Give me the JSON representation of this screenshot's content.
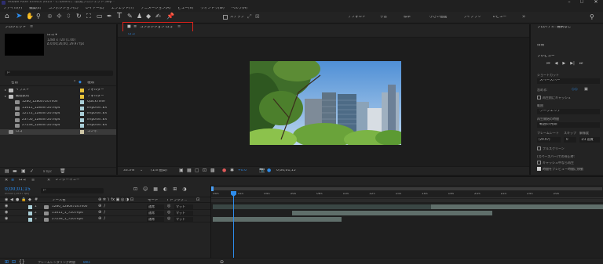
{
  "title_bar": {
    "title": "Adobe After Effects 2023 - C:\\Users\\...\\新規プロジェクト.aep *"
  },
  "menu": [
    "ファイル(F)",
    "編集(E)",
    "コンポジション(C)",
    "レイヤー(L)",
    "エフェクト(T)",
    "アニメーション(A)",
    "ビュー(V)",
    "ウィンドウ(W)",
    "ヘルプ(H)"
  ],
  "toolbar": {
    "snap_label": "スナップ",
    "workspaces": [
      "デフォルト",
      "学習",
      "標準",
      "小さい画面",
      "ライブラリ",
      "レビュー"
    ]
  },
  "project_panel": {
    "title": "プロジェクト",
    "comp_name": "ロゴ ▾",
    "comp_info": [
      "1280 x 720 (1.00)",
      "Δ 0;00;26;00, 29.97 fps"
    ],
    "search_placeholder": "ρ.",
    "col_name": "名前",
    "col_type": "種類",
    "items": [
      {
        "name": "イラスト",
        "type": "フォルダー",
        "indent": 0,
        "color": "#e8c33a"
      },
      {
        "name": "動画素材",
        "type": "フォルダー",
        "indent": 0,
        "color": "#e8c33a"
      },
      {
        "name": "1280_1280x720.mov",
        "type": "QuickTime",
        "indent": 1,
        "color": "#aacfd8"
      },
      {
        "name": "11011_1280x720.mp4",
        "type": "Importe..EX",
        "indent": 1,
        "color": "#aacfd8"
      },
      {
        "name": "12172_1280x720.mp4",
        "type": "Importe..EX",
        "indent": 1,
        "color": "#aacfd8"
      },
      {
        "name": "23750_1280x720.mp4",
        "type": "Importe..EX",
        "indent": 1,
        "color": "#aacfd8"
      },
      {
        "name": "27239_1280x720.mp4",
        "type": "Importe..EX",
        "indent": 1,
        "color": "#aacfd8"
      },
      {
        "name": "ロゴ",
        "type": "コンポ",
        "indent": 0,
        "color": "#cfc6a6"
      }
    ],
    "bpc_label": "8 bpc"
  },
  "composition_panel": {
    "tab_label": "コンポジション ロゴ",
    "breadcrumb": "ロゴ",
    "zoom": "33.3%",
    "resolution": "(1/3 画質)",
    "exposure": "+0.0",
    "timecode": "0;00;01;15"
  },
  "right_panel": {
    "props_title": "プロパティ: 選択なし",
    "info_label": "情報",
    "preview_title": "プレビュー",
    "shortcut_label": "ショートカット",
    "shortcut_value": "スペースバー",
    "include_label": "含める:",
    "cache_label": "再生前にキャッシュ",
    "range_label": "範囲",
    "range_value": "ワークエリア",
    "play_from_label": "再生開始の時間",
    "play_from_value": "範囲の先頭",
    "frame_rate_label": "フレームレート",
    "skip_label": "スキップ",
    "resolution_label": "解像度",
    "frame_rate_value": "(29.97)",
    "skip_value": "0",
    "resolution_value": "1/3 画質",
    "fullscreen_label": "フルスクリーン",
    "stop_label": "(スペースバー)での停止時:",
    "if_cache_label": "キャッシュ中なら再生",
    "move_time_label": "時間をプレビュー時間に移動"
  },
  "timeline": {
    "comp_tab": "ロゴ",
    "render_tab": "レンダーキュー",
    "current_time": "0;00;01;15",
    "frame_info": "00045 (29.97 fps)",
    "search_placeholder": "ρ.",
    "col_source": "ソース名",
    "col_mode": "モード",
    "col_trkmat": "T トラック...",
    "layers": [
      {
        "num": "1",
        "name": "1280_1280x720.mov",
        "mode": "通常",
        "mat": "マット",
        "color": "#aacfd8"
      },
      {
        "num": "2",
        "name": "11011_1_720.mp4",
        "mode": "通常",
        "mat": "マット",
        "color": "#aacfd8"
      },
      {
        "num": "3",
        "name": "27239_1_720.mp4",
        "mode": "通常",
        "mat": "マット",
        "color": "#aacfd8"
      }
    ],
    "ruler_labels": [
      "00s",
      "02s",
      "04s",
      "06s",
      "08s",
      "10s",
      "12s",
      "14s",
      "16s",
      "18s",
      "20s",
      "22s",
      "24s",
      "26s"
    ],
    "render_time_label": "フレームレンダリング時間",
    "render_time_value": "0ms"
  },
  "colors": {
    "accent": "#2d8ceb",
    "highlight_box": "#e0231c",
    "panel_bg": "#232323",
    "dark_bg": "#1d1d1d"
  }
}
